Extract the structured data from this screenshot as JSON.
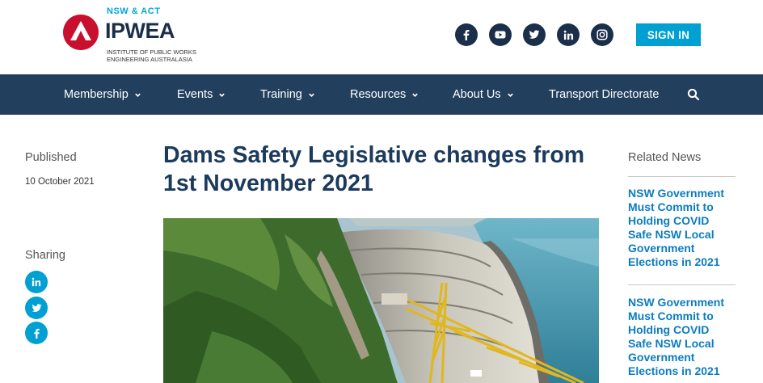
{
  "header": {
    "logo": {
      "region": "NSW & ACT",
      "name": "IPWEA",
      "subtitle": "INSTITUTE OF PUBLIC WORKS ENGINEERING AUSTRALASIA"
    },
    "social": [
      "facebook-icon",
      "youtube-icon",
      "twitter-icon",
      "linkedin-icon",
      "instagram-icon"
    ],
    "signin_label": "SIGN IN"
  },
  "nav": {
    "items": [
      {
        "label": "Membership",
        "dropdown": true
      },
      {
        "label": "Events",
        "dropdown": true
      },
      {
        "label": "Training",
        "dropdown": true
      },
      {
        "label": "Resources",
        "dropdown": true
      },
      {
        "label": "About Us",
        "dropdown": true
      },
      {
        "label": "Transport Directorate",
        "dropdown": false
      }
    ],
    "search_icon": "search-icon"
  },
  "article": {
    "published_label": "Published",
    "published_date": "10 October 2021",
    "sharing_label": "Sharing",
    "share_buttons": [
      "linkedin-icon",
      "twitter-icon",
      "facebook-icon"
    ],
    "title": "Dams Safety Legislative changes from 1st November 2021"
  },
  "related": {
    "label": "Related News",
    "items": [
      {
        "title": "NSW Government Must Commit to Holding COVID Safe NSW Local Government Elections in 2021"
      },
      {
        "title": "NSW Government Must Commit to Holding COVID Safe NSW Local Government Elections in 2021"
      }
    ]
  },
  "colors": {
    "navy": "#22405e",
    "brand_red": "#c8102e",
    "accent_blue": "#00a0d2",
    "link_blue": "#0b7cc0",
    "title_navy": "#1b3a5c"
  }
}
